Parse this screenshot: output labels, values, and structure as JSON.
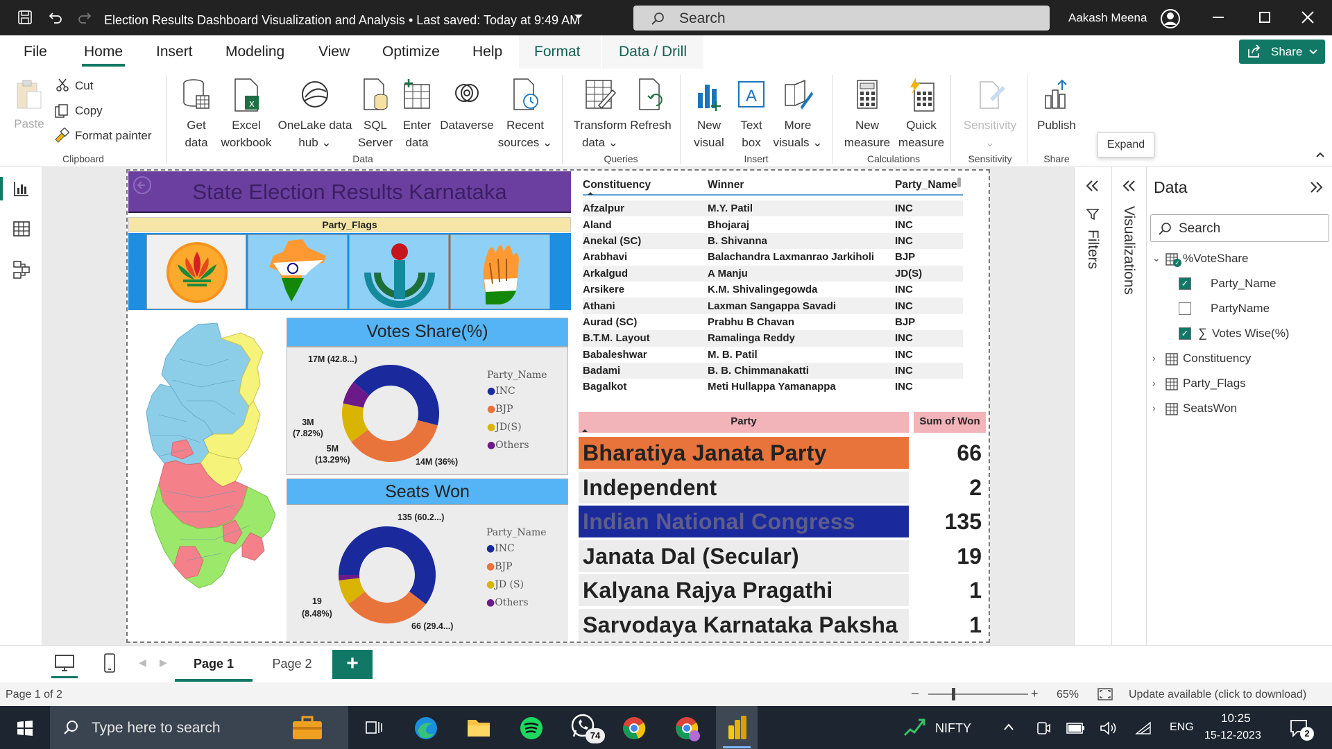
{
  "titlebar": {
    "title": "Election Results Dashboard Visualization and Analysis",
    "saved": "Last saved: Today at 9:49 AM",
    "search_placeholder": "Search",
    "user": "Aakash Meena"
  },
  "menu": [
    "File",
    "Home",
    "Insert",
    "Modeling",
    "View",
    "Optimize",
    "Help",
    "Format",
    "Data / Drill"
  ],
  "share_label": "Share",
  "ribbon": {
    "clipboard": {
      "paste": "Paste",
      "cut": "Cut",
      "copy": "Copy",
      "format_painter": "Format painter",
      "group": "Clipboard"
    },
    "data": {
      "get_data": [
        "Get",
        "data"
      ],
      "excel": [
        "Excel",
        "workbook"
      ],
      "onelake": [
        "OneLake data",
        "hub"
      ],
      "sql": [
        "SQL",
        "Server"
      ],
      "enter": [
        "Enter",
        "data"
      ],
      "dataverse": "Dataverse",
      "recent": [
        "Recent",
        "sources"
      ],
      "group": "Data"
    },
    "queries": {
      "transform": [
        "Transform",
        "data"
      ],
      "refresh": "Refresh",
      "group": "Queries"
    },
    "insert": {
      "new_visual": [
        "New",
        "visual"
      ],
      "text_box": [
        "Text",
        "box"
      ],
      "more_visuals": [
        "More",
        "visuals"
      ],
      "group": "Insert"
    },
    "calculations": {
      "new_measure": [
        "New",
        "measure"
      ],
      "quick_measure": [
        "Quick",
        "measure"
      ],
      "group": "Calculations"
    },
    "sensitivity": {
      "label": "Sensitivity",
      "group": "Sensitivity"
    },
    "share": {
      "publish": "Publish",
      "group": "Share"
    },
    "tooltip": "Expand"
  },
  "report": {
    "title": "State Election Results Karnataka",
    "flags_header": "Party_Flags",
    "votes_title": "Votes Share(%)",
    "seats_title": "Seats Won",
    "legend_title": "Party_Name",
    "legend_items_votes": [
      "INC",
      "BJP",
      "JD(S)",
      "Others"
    ],
    "legend_items_seats": [
      "INC",
      "BJP",
      "JD (S)",
      "Others"
    ],
    "legend_colors": [
      "#1a2a9c",
      "#e8743b",
      "#d9b400",
      "#6c1a8a"
    ],
    "votes_labels": {
      "inc": "17M (42.8...)",
      "bjp": "14M (36%)",
      "jds": [
        "5M",
        "(13.29%)"
      ],
      "others": [
        "3M",
        "(7.82%)"
      ]
    },
    "seats_labels": {
      "inc": "135 (60.2...)",
      "bjp": "66 (29.4...)",
      "jds": [
        "19",
        "(8.48%)"
      ]
    }
  },
  "chart_data": [
    {
      "type": "pie",
      "title": "Votes Share(%)",
      "legend_title": "Party_Name",
      "categories": [
        "INC",
        "BJP",
        "JD(S)",
        "Others"
      ],
      "values": [
        42.8,
        36.0,
        13.29,
        7.82
      ],
      "value_labels": [
        "17M",
        "14M",
        "5M",
        "3M"
      ],
      "colors": [
        "#1a2a9c",
        "#e8743b",
        "#d9b400",
        "#6c1a8a"
      ]
    },
    {
      "type": "pie",
      "title": "Seats Won",
      "legend_title": "Party_Name",
      "categories": [
        "INC",
        "BJP",
        "JD (S)",
        "Others"
      ],
      "values": [
        135,
        66,
        19,
        4
      ],
      "colors": [
        "#1a2a9c",
        "#e8743b",
        "#d9b400",
        "#6c1a8a"
      ]
    }
  ],
  "constituency_table": {
    "headers": [
      "Constituency",
      "Winner",
      "Party_Name"
    ],
    "rows": [
      [
        "Afzalpur",
        "M.Y. Patil",
        "INC"
      ],
      [
        "Aland",
        "Bhojaraj",
        "INC"
      ],
      [
        "Anekal (SC)",
        "B. Shivanna",
        "INC"
      ],
      [
        "Arabhavi",
        "Balachandra Laxmanrao Jarkiholi",
        "BJP"
      ],
      [
        "Arkalgud",
        "A Manju",
        "JD(S)"
      ],
      [
        "Arsikere",
        "K.M. Shivalingegowda",
        "INC"
      ],
      [
        "Athani",
        "Laxman Sangappa Savadi",
        "INC"
      ],
      [
        "Aurad (SC)",
        "Prabhu B Chavan",
        "BJP"
      ],
      [
        "B.T.M. Layout",
        "Ramalinga Reddy",
        "INC"
      ],
      [
        "Babaleshwar",
        "M. B. Patil",
        "INC"
      ],
      [
        "Badami",
        "B. B. Chimmanakatti",
        "INC"
      ],
      [
        "Bagalkot",
        "Meti Hullappa Yamanappa",
        "INC"
      ]
    ]
  },
  "party_table": {
    "headers": [
      "Party",
      "Sum of Won"
    ],
    "rows": [
      {
        "party": "Bharatiya Janata Party",
        "won": "66",
        "bg": "#e8743b",
        "color": "#222"
      },
      {
        "party": "Independent",
        "won": "2",
        "bg": "#ececec",
        "color": "#222"
      },
      {
        "party": "Indian National Congress",
        "won": "135",
        "bg": "#1a2a9c",
        "color": "#5d5d8a"
      },
      {
        "party": "Janata Dal (Secular)",
        "won": "19",
        "bg": "#ececec",
        "color": "#222"
      },
      {
        "party": "Kalyana Rajya Pragathi Paksha",
        "won": "1",
        "bg": "#ececec",
        "color": "#222"
      },
      {
        "party": "Sarvodaya Karnataka Paksha",
        "won": "1",
        "bg": "#ececec",
        "color": "#222"
      }
    ]
  },
  "panes": {
    "filters": "Filters",
    "visualizations": "Visualizations",
    "data_title": "Data",
    "data_search": "Search"
  },
  "data_tree": [
    {
      "label": "%VoteShare",
      "level": 0,
      "expanded": true
    },
    {
      "label": "Party_Name",
      "level": 1,
      "checked": true
    },
    {
      "label": "PartyName",
      "level": 1,
      "checked": false
    },
    {
      "label": "Votes Wise(%)",
      "level": 1,
      "checked": true,
      "sigma": true
    },
    {
      "label": "Constituency",
      "level": 0,
      "expanded": false
    },
    {
      "label": "Party_Flags",
      "level": 0,
      "expanded": false
    },
    {
      "label": "SeatsWon",
      "level": 0,
      "expanded": false
    }
  ],
  "pages": [
    "Page 1",
    "Page 2"
  ],
  "status": {
    "page": "Page 1 of 2",
    "zoom": "65%",
    "update": "Update available (click to download)"
  },
  "taskbar": {
    "search": "Type here to search",
    "whatsapp_badge": "74",
    "nifty": "NIFTY",
    "lang": "ENG",
    "time": "10:25",
    "date": "15-12-2023",
    "notif": "2"
  }
}
